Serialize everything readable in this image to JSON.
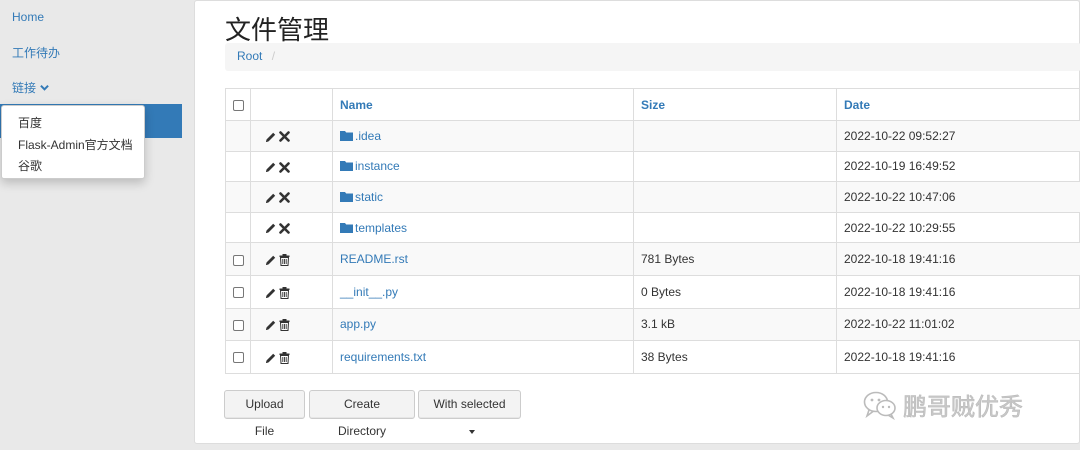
{
  "sidebar": {
    "home": "Home",
    "todo": "工作待办",
    "links": "链接",
    "links_icon": "chevron-down-icon",
    "dropdown": [
      "百度",
      "Flask-Admin官方文档",
      "谷歌"
    ]
  },
  "page": {
    "title": "文件管理",
    "breadcrumb_root": "Root",
    "breadcrumb_sep": "/"
  },
  "table": {
    "headers": {
      "name": "Name",
      "size": "Size",
      "date": "Date"
    },
    "rows": [
      {
        "name": ".idea",
        "type": "folder",
        "size": "",
        "date": "2022-10-22 09:52:27"
      },
      {
        "name": "instance",
        "type": "folder",
        "size": "",
        "date": "2022-10-19 16:49:52"
      },
      {
        "name": "static",
        "type": "folder",
        "size": "",
        "date": "2022-10-22 10:47:06"
      },
      {
        "name": "templates",
        "type": "folder",
        "size": "",
        "date": "2022-10-22 10:29:55"
      },
      {
        "name": "README.rst",
        "type": "file",
        "size": "781 Bytes",
        "date": "2022-10-18 19:41:16"
      },
      {
        "name": "__init__.py",
        "type": "file",
        "size": "0 Bytes",
        "date": "2022-10-18 19:41:16"
      },
      {
        "name": "app.py",
        "type": "file",
        "size": "3.1 kB",
        "date": "2022-10-22 11:01:02"
      },
      {
        "name": "requirements.txt",
        "type": "file",
        "size": "38 Bytes",
        "date": "2022-10-18 19:41:16"
      }
    ]
  },
  "buttons": {
    "upload": "Upload File",
    "mkdir": "Create Directory",
    "with_selected": "With selected"
  },
  "watermark": "鹏哥贼优秀",
  "colors": {
    "link": "#337ab7",
    "active": "#337ab7"
  }
}
